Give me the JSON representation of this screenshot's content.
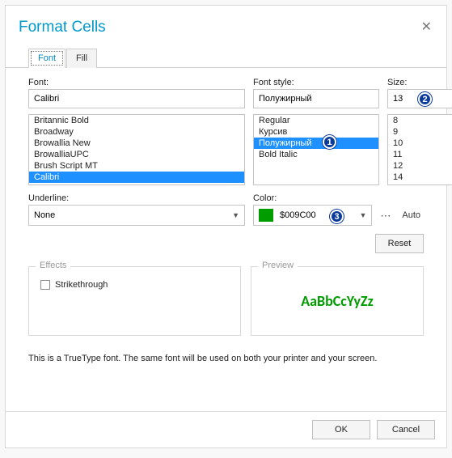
{
  "dialog": {
    "title": "Format Cells"
  },
  "tabs": {
    "font": "Font",
    "fill": "Fill"
  },
  "labels": {
    "font": "Font:",
    "font_style": "Font style:",
    "size": "Size:",
    "underline": "Underline:",
    "color": "Color:",
    "effects": "Effects",
    "strikethrough": "Strikethrough",
    "preview": "Preview",
    "reset": "Reset",
    "auto": "Auto",
    "note": "This is a TrueType font. The same font will be used on both your printer and your screen.",
    "ok": "OK",
    "cancel": "Cancel"
  },
  "font": {
    "value": "Calibri",
    "list": [
      "Britannic Bold",
      "Broadway",
      "Browallia New",
      "BrowalliaUPC",
      "Brush Script MT",
      "Calibri"
    ],
    "selected": "Calibri"
  },
  "font_style": {
    "value": "Полужирный",
    "list": [
      "Regular",
      "Курсив",
      "Полужирный",
      "Bold Italic"
    ],
    "selected": "Полужирный"
  },
  "size": {
    "value": "13",
    "list": [
      "8",
      "9",
      "10",
      "11",
      "12",
      "14"
    ]
  },
  "underline": {
    "value": "None"
  },
  "color": {
    "value": "$009C00",
    "swatch": "#009c00"
  },
  "preview": {
    "sample": "AaBbCcYyZz"
  },
  "annotations": {
    "b1": "1",
    "b2": "2",
    "b3": "3"
  }
}
